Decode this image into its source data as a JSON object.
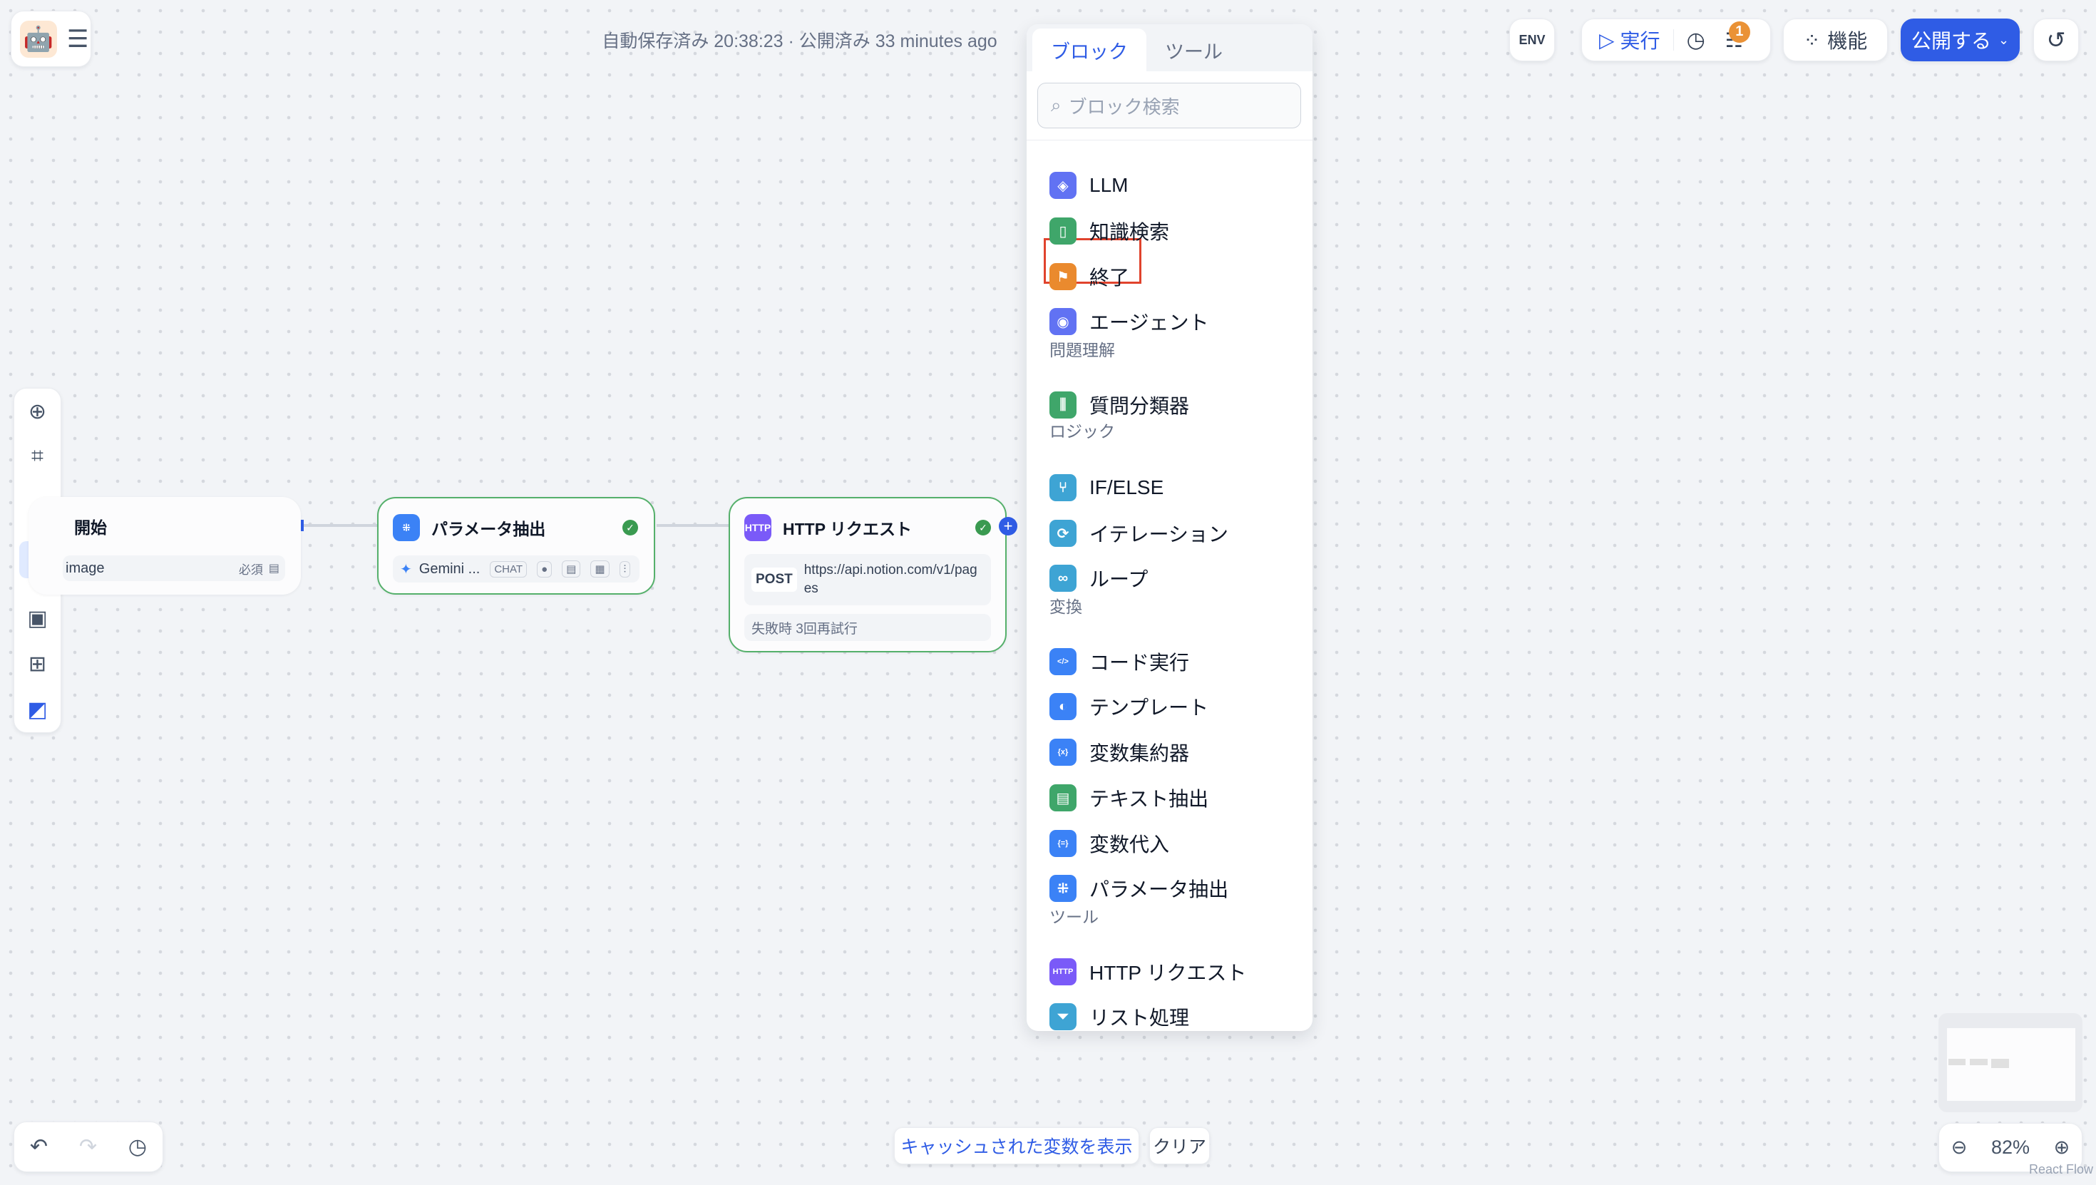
{
  "header": {
    "status": "自動保存済み 20:38:23 · 公開済み 33 minutes ago"
  },
  "toolbar": {
    "env": "ENV",
    "run": "実行",
    "checklist_badge": "1",
    "features": "機能",
    "publish": "公開する"
  },
  "panel": {
    "tabs": [
      {
        "label": "ブロック",
        "active": true
      },
      {
        "label": "ツール",
        "active": false
      }
    ],
    "search_placeholder": "ブロック検索",
    "items": [
      {
        "label": "LLM",
        "color": "#6172f3",
        "icon": "llm-icon"
      },
      {
        "label": "知識検索",
        "color": "#3fa66a",
        "icon": "book-icon"
      },
      {
        "label": "終了",
        "color": "#ea8a2e",
        "icon": "end-icon",
        "highlighted": true
      },
      {
        "label": "エージェント",
        "color": "#6172f3",
        "icon": "agent-icon"
      },
      {
        "label": "質問分類器",
        "color": "#3fa66a",
        "icon": "classifier-icon"
      },
      {
        "label": "IF/ELSE",
        "color": "#3ea4d4",
        "icon": "branch-icon"
      },
      {
        "label": "イテレーション",
        "color": "#3ea4d4",
        "icon": "iteration-icon"
      },
      {
        "label": "ループ",
        "color": "#3ea4d4",
        "icon": "loop-icon"
      },
      {
        "label": "コード実行",
        "color": "#3b82f6",
        "icon": "code-icon"
      },
      {
        "label": "テンプレート",
        "color": "#3b82f6",
        "icon": "template-icon"
      },
      {
        "label": "変数集約器",
        "color": "#3b82f6",
        "icon": "variable-aggregator-icon"
      },
      {
        "label": "テキスト抽出",
        "color": "#3fa66a",
        "icon": "text-extract-icon"
      },
      {
        "label": "変数代入",
        "color": "#3b82f6",
        "icon": "variable-assign-icon"
      },
      {
        "label": "パラメータ抽出",
        "color": "#3b82f6",
        "icon": "parameter-icon"
      },
      {
        "label": "HTTP リクエスト",
        "color": "#7a5af8",
        "icon": "http-icon"
      },
      {
        "label": "リスト処理",
        "color": "#3ea4d4",
        "icon": "filter-icon"
      }
    ],
    "categories": [
      "問題理解",
      "ロジック",
      "変換",
      "ツール"
    ]
  },
  "nodes": {
    "start": {
      "title": "開始",
      "var": "image",
      "required": "必須"
    },
    "param": {
      "title": "パラメータ抽出",
      "model": "Gemini ...",
      "chip": "CHAT"
    },
    "http": {
      "title": "HTTP リクエスト",
      "icon_text": "HTTP",
      "method": "POST",
      "url": "https://api.notion.com/v1/pages",
      "retry": "失敗時 3回再試行"
    }
  },
  "bottom": {
    "cache": "キャッシュされた変数を表示",
    "clear": "クリア",
    "zoom": "82%",
    "attribution": "React Flow"
  }
}
